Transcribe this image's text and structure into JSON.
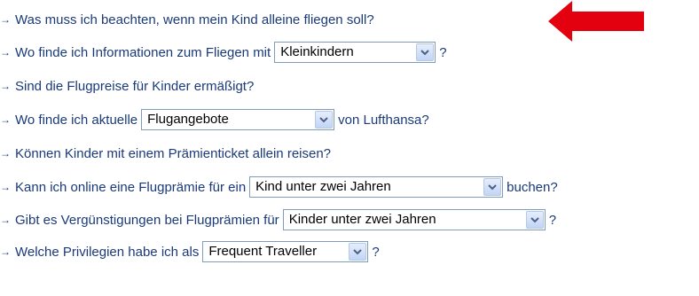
{
  "arrow_glyph": "→",
  "faq": [
    {
      "prefix": "Was muss ich beachten, wenn mein Kind alleine fliegen soll?"
    },
    {
      "prefix": "Wo finde ich Informationen zum Fliegen mit",
      "select": "Kleinkindern",
      "suffix": "?"
    },
    {
      "prefix": "Sind die Flugpreise für Kinder ermäßigt?"
    },
    {
      "prefix": "Wo finde ich aktuelle",
      "select": "Flugangebote",
      "suffix": "von Lufthansa?"
    },
    {
      "prefix": "Können Kinder mit einem Prämienticket allein reisen?"
    },
    {
      "prefix": "Kann ich online eine Flugprämie für ein",
      "select": "Kind unter zwei Jahren",
      "suffix": "buchen?"
    },
    {
      "prefix": "Gibt es Vergünstigungen bei Flugprämien für",
      "select": "Kinder unter zwei Jahren",
      "suffix": "?"
    },
    {
      "prefix": "Welche Privilegien habe ich als",
      "select": "Frequent Traveller",
      "suffix": "?"
    }
  ],
  "colors": {
    "link": "#1a3a78",
    "annotation_arrow": "#e3000f"
  }
}
